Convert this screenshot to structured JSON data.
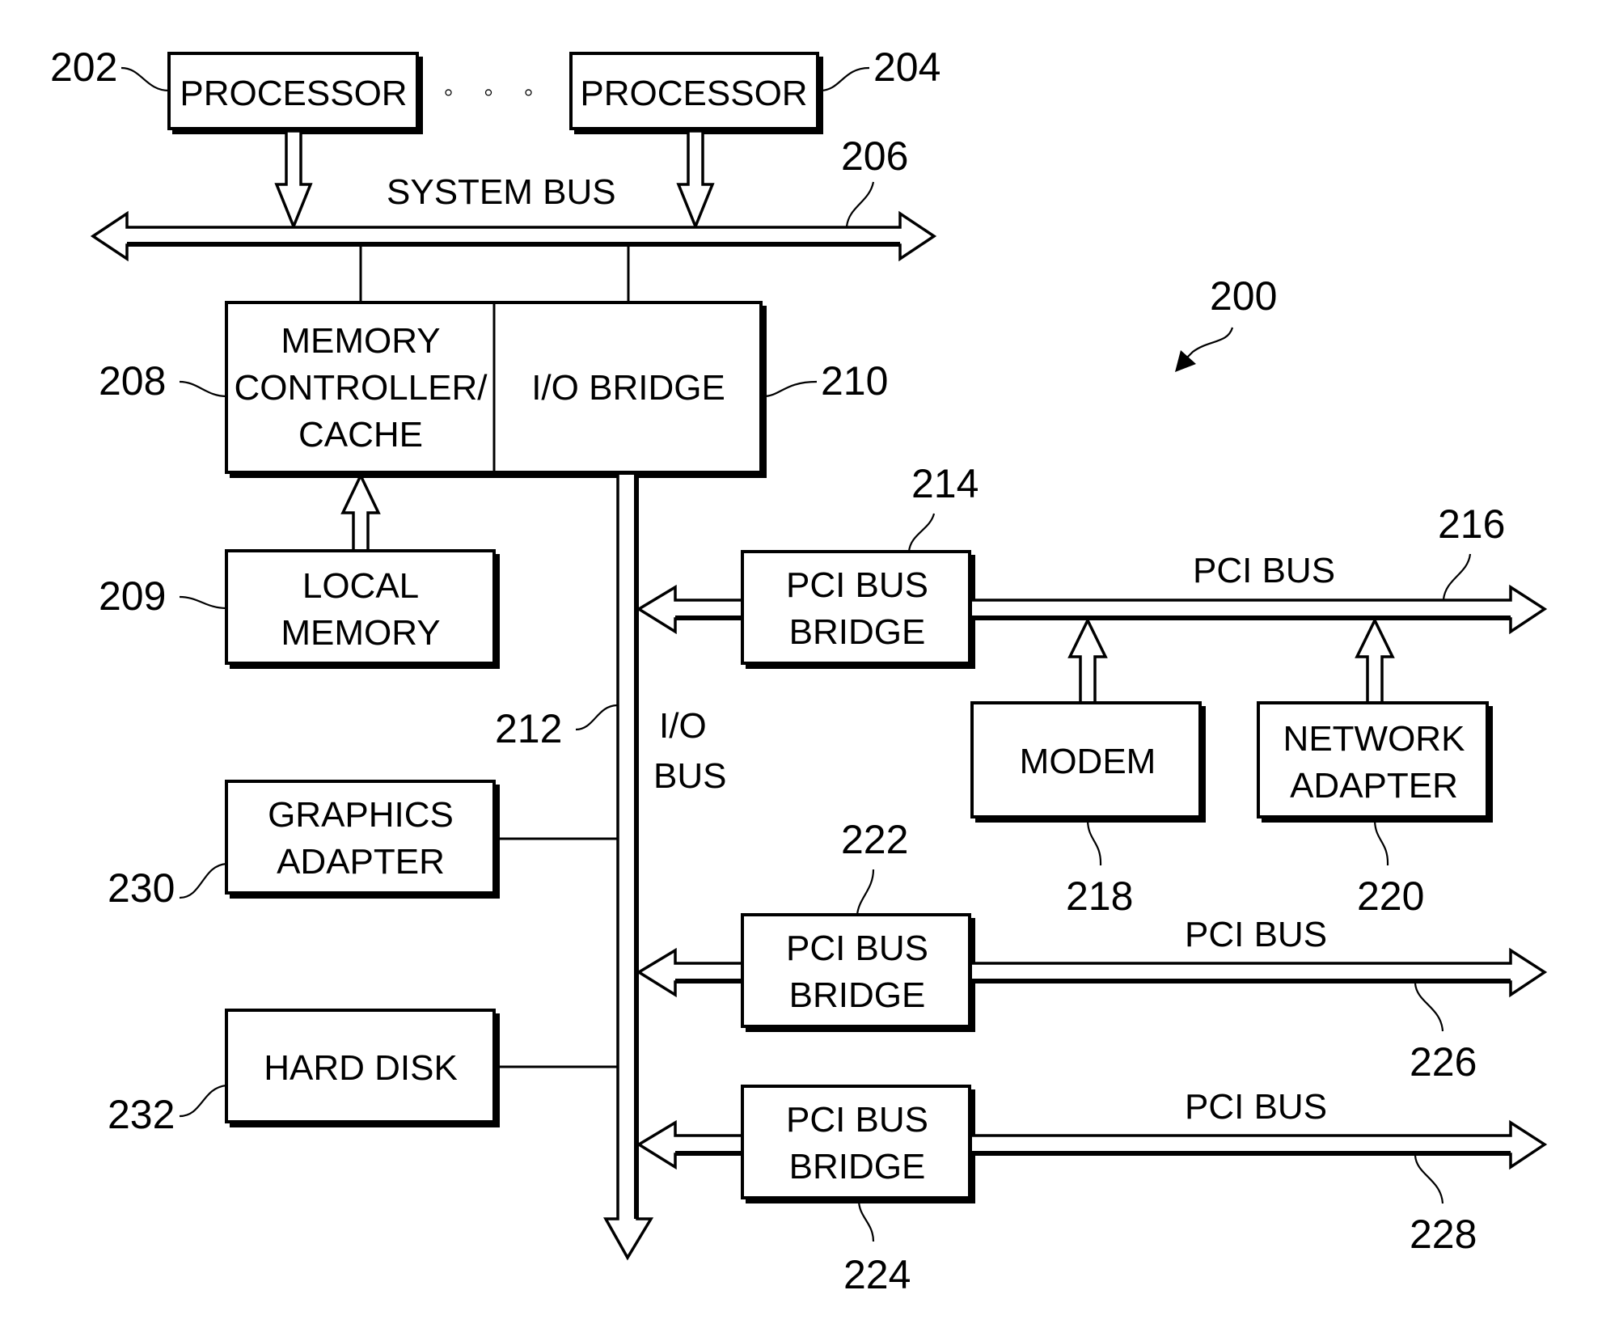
{
  "figure": {
    "reference": "200",
    "components": {
      "processor_1": {
        "ref": "202",
        "lines": [
          "PROCESSOR"
        ]
      },
      "processor_2": {
        "ref": "204",
        "lines": [
          "PROCESSOR"
        ]
      },
      "ellipsis": "◦ ◦ ◦",
      "system_bus": {
        "ref": "206",
        "label": "SYSTEM BUS"
      },
      "memory_controller": {
        "ref": "208",
        "lines": [
          "MEMORY",
          "CONTROLLER/",
          "CACHE"
        ]
      },
      "local_memory": {
        "ref": "209",
        "lines": [
          "LOCAL",
          "MEMORY"
        ]
      },
      "io_bridge": {
        "ref": "210",
        "lines": [
          "I/O BRIDGE"
        ]
      },
      "io_bus": {
        "ref": "212",
        "lines": [
          "I/O",
          "BUS"
        ]
      },
      "pci_bridge_1": {
        "ref": "214",
        "lines": [
          "PCI BUS",
          "BRIDGE"
        ]
      },
      "pci_bus_1": {
        "ref": "216",
        "label": "PCI BUS"
      },
      "modem": {
        "ref": "218",
        "lines": [
          "MODEM"
        ]
      },
      "network_adapter": {
        "ref": "220",
        "lines": [
          "NETWORK",
          "ADAPTER"
        ]
      },
      "pci_bridge_2": {
        "ref": "222",
        "lines": [
          "PCI BUS",
          "BRIDGE"
        ]
      },
      "pci_bridge_3": {
        "ref": "224",
        "lines": [
          "PCI BUS",
          "BRIDGE"
        ]
      },
      "pci_bus_2": {
        "ref": "226",
        "label": "PCI BUS"
      },
      "pci_bus_3": {
        "ref": "228",
        "label": "PCI BUS"
      },
      "graphics_adapter": {
        "ref": "230",
        "lines": [
          "GRAPHICS",
          "ADAPTER"
        ]
      },
      "hard_disk": {
        "ref": "232",
        "lines": [
          "HARD DISK"
        ]
      }
    }
  }
}
